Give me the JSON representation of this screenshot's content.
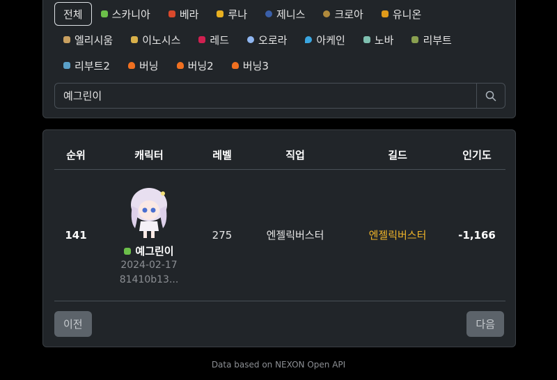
{
  "worlds": [
    {
      "label": "전체",
      "icon": "",
      "active": true
    },
    {
      "label": "스카니아",
      "icon": "scania-world-icon",
      "color": "#6cbf4a"
    },
    {
      "label": "베라",
      "icon": "bera-world-icon",
      "color": "#d9482b"
    },
    {
      "label": "루나",
      "icon": "luna-world-icon",
      "color": "#e8b020"
    },
    {
      "label": "제니스",
      "icon": "zenith-world-icon",
      "color": "#3a5fa8"
    },
    {
      "label": "크로아",
      "icon": "croa-world-icon",
      "color": "#b08a3c"
    },
    {
      "label": "유니온",
      "icon": "union-world-icon",
      "color": "#e09a1a"
    },
    {
      "label": "엘리시움",
      "icon": "elysium-world-icon",
      "color": "#c9a060"
    },
    {
      "label": "이노시스",
      "icon": "enosis-world-icon",
      "color": "#d8b04a"
    },
    {
      "label": "레드",
      "icon": "red-world-icon",
      "color": "#d02050"
    },
    {
      "label": "오로라",
      "icon": "aurora-world-icon",
      "color": "#8fb6f0"
    },
    {
      "label": "아케인",
      "icon": "arcane-world-icon",
      "color": "#3aa6e0"
    },
    {
      "label": "노바",
      "icon": "nova-world-icon",
      "color": "#7fc0b0"
    },
    {
      "label": "리부트",
      "icon": "reboot-world-icon",
      "color": "#8aa050"
    },
    {
      "label": "리부트2",
      "icon": "reboot2-world-icon",
      "color": "#5aa0c8"
    },
    {
      "label": "버닝",
      "icon": "burning-world-icon",
      "color": "#f07020"
    },
    {
      "label": "버닝2",
      "icon": "burning2-world-icon",
      "color": "#f07020"
    },
    {
      "label": "버닝3",
      "icon": "burning3-world-icon",
      "color": "#f07020"
    }
  ],
  "search": {
    "value": "예그린이"
  },
  "table": {
    "headers": [
      "순위",
      "캐릭터",
      "레벨",
      "직업",
      "길드",
      "인기도"
    ],
    "row": {
      "rank": "141",
      "name": "예그린이",
      "date": "2024-02-17",
      "id": "81410b13...",
      "level": "275",
      "job": "엔젤릭버스터",
      "guild": "엔젤릭버스터",
      "popularity": "-1,166"
    }
  },
  "pagination": {
    "prev": "이전",
    "next": "다음"
  },
  "footer": "Data based on NEXON Open API"
}
